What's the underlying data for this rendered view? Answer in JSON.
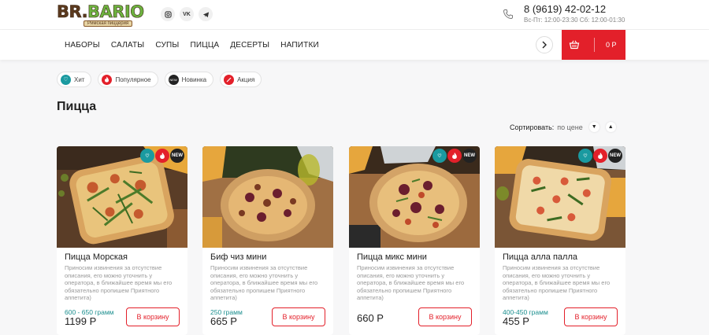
{
  "header": {
    "logo_text_1": "BR.",
    "logo_text_2": "BARIO",
    "logo_sub": "Римская пиццерия",
    "phone": "8 (9619) 42-02-12",
    "hours": "Вс-Пт: 12:00-23:30 Сб: 12:00-01:30",
    "socials": [
      "instagram-icon",
      "vk-icon",
      "telegram-icon"
    ]
  },
  "nav": {
    "items": [
      "НАБОРЫ",
      "САЛАТЫ",
      "СУПЫ",
      "ПИЦЦА",
      "ДЕСЕРТЫ",
      "НАПИТКИ"
    ],
    "cart_sum": "0 Р"
  },
  "filters": [
    {
      "label": "Хит",
      "color": "#1a9aa0",
      "icon": "heart-icon"
    },
    {
      "label": "Популярное",
      "color": "#e3202a",
      "icon": "flame-icon"
    },
    {
      "label": "Новинка",
      "color": "#222222",
      "icon": "new-icon"
    },
    {
      "label": "Акция",
      "color": "#e3202a",
      "icon": "percent-icon"
    }
  ],
  "page": {
    "title": "Пицца",
    "sort_label": "Сортировать:",
    "sort_value": "по цене"
  },
  "products": [
    {
      "name": "Пицца Морская",
      "desc": "Приносим извинения за отсутствие описания, его можно уточнить у оператора, в ближайшее время мы его обязательно пропишем Приятного аппетита)",
      "weight": "600 - 650 грамм",
      "price": "1199 Р",
      "buy": "В корзину",
      "badges": true
    },
    {
      "name": "Биф чиз мини",
      "desc": "Приносим извинения за отсутствие описания, его можно уточнить у оператора, в ближайшее время мы его обязательно пропишем Приятного аппетита)",
      "weight": "250 грамм",
      "price": "665 Р",
      "buy": "В корзину",
      "badges": false
    },
    {
      "name": "Пицца микс мини",
      "desc": "Приносим извинения за отсутствие описания, его можно уточнить у оператора, в ближайшее время мы его обязательно пропишем Приятного аппетита)",
      "weight": "",
      "price": "660 Р",
      "buy": "В корзину",
      "badges": true
    },
    {
      "name": "Пицца алла палла",
      "desc": "Приносим извинения за отсутствие описания, его можно уточнить у оператора, в ближайшее время мы его обязательно пропишем Приятного аппетита)",
      "weight": "400-450 грамм",
      "price": "455 Р",
      "buy": "В корзину",
      "badges": true
    }
  ],
  "badge_new": "NEW",
  "colors": {
    "accent": "#e3202a",
    "teal": "#1a9aa0"
  }
}
